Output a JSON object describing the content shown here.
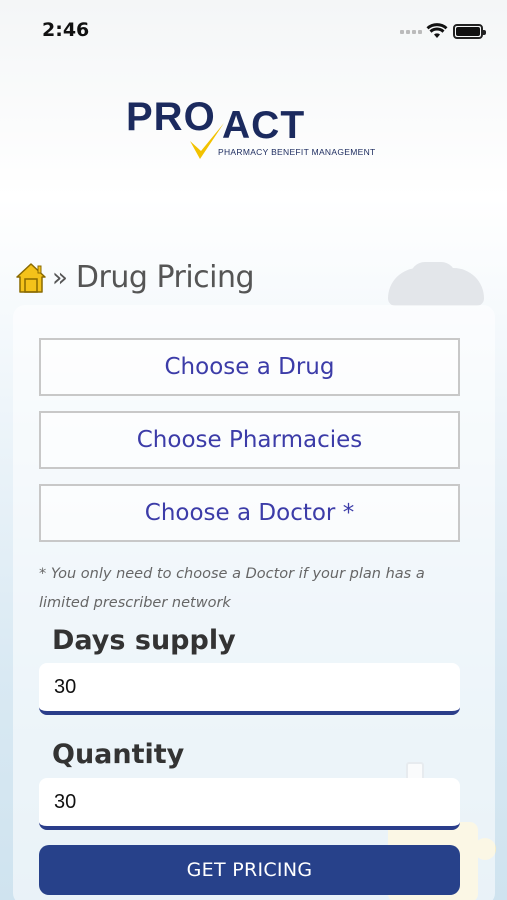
{
  "status": {
    "time": "2:46"
  },
  "logo": {
    "part1": "PRO",
    "part2": "ACT",
    "tagline": "PHARMACY BENEFIT MANAGEMENT"
  },
  "breadcrumb": {
    "separator": "»",
    "title": "Drug Pricing"
  },
  "buttons": {
    "choose_drug": "Choose a Drug",
    "choose_pharmacies": "Choose Pharmacies",
    "choose_doctor": "Choose a Doctor *"
  },
  "note": "* You only need to choose a Doctor if your plan has a limited prescriber network",
  "days_supply": {
    "label": "Days supply",
    "value": "30"
  },
  "quantity": {
    "label": "Quantity",
    "value": "30"
  },
  "submit": {
    "label": "GET PRICING"
  },
  "colors": {
    "brand_navy": "#1b2a5e",
    "button_blue": "#27418a",
    "link_purple": "#3c3ca8",
    "check_yellow": "#f2c200"
  }
}
